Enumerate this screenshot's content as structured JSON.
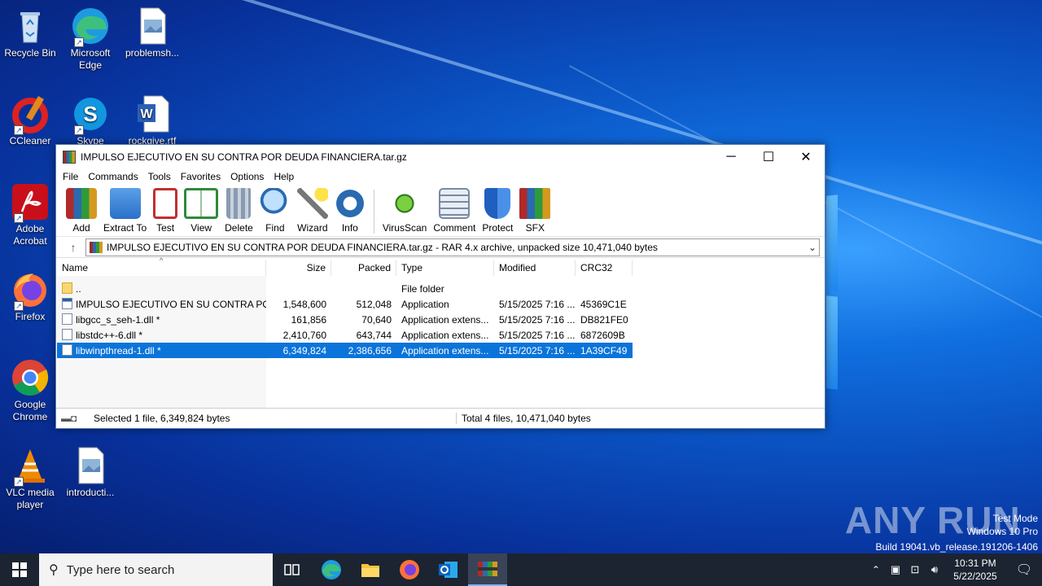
{
  "desktop": {
    "icons": [
      {
        "label": "Recycle Bin",
        "icon": "recycle-bin-icon"
      },
      {
        "label": "Microsoft Edge",
        "icon": "edge-icon"
      },
      {
        "label": "problemsh...",
        "icon": "image-file-icon"
      },
      {
        "label": "CCleaner",
        "icon": "ccleaner-icon"
      },
      {
        "label": "Skype",
        "icon": "skype-icon"
      },
      {
        "label": "rockgive.rtf",
        "icon": "word-doc-icon"
      },
      {
        "label": "Adobe Acrobat",
        "icon": "acrobat-icon"
      },
      {
        "label": "Firefox",
        "icon": "firefox-icon"
      },
      {
        "label": "Google Chrome",
        "icon": "chrome-icon"
      },
      {
        "label": "VLC media player",
        "icon": "vlc-icon"
      },
      {
        "label": "introducti...",
        "icon": "image-file-icon"
      }
    ],
    "watermark": {
      "brand": "ANY RUN",
      "line1": "Test Mode",
      "line2": "Windows 10 Pro",
      "line3": "Build 19041.vb_release.191206-1406"
    }
  },
  "window": {
    "title": "IMPULSO EJECUTIVO EN SU CONTRA POR DEUDA FINANCIERA.tar.gz",
    "menu": [
      "File",
      "Commands",
      "Tools",
      "Favorites",
      "Options",
      "Help"
    ],
    "toolbar": [
      {
        "label": "Add",
        "icon": "add-archive-icon"
      },
      {
        "label": "Extract To",
        "icon": "extract-folder-icon"
      },
      {
        "label": "Test",
        "icon": "test-clipboard-icon"
      },
      {
        "label": "View",
        "icon": "view-book-icon"
      },
      {
        "label": "Delete",
        "icon": "trash-icon"
      },
      {
        "label": "Find",
        "icon": "magnifier-icon"
      },
      {
        "label": "Wizard",
        "icon": "wand-icon"
      },
      {
        "label": "Info",
        "icon": "info-icon"
      },
      {
        "label": "VirusScan",
        "icon": "virus-icon"
      },
      {
        "label": "Comment",
        "icon": "comment-icon"
      },
      {
        "label": "Protect",
        "icon": "shield-icon"
      },
      {
        "label": "SFX",
        "icon": "sfx-icon"
      }
    ],
    "address": "IMPULSO EJECUTIVO EN SU CONTRA POR DEUDA FINANCIERA.tar.gz - RAR 4.x archive, unpacked size 10,471,040 bytes",
    "columns": [
      "Name",
      "Size",
      "Packed",
      "Type",
      "Modified",
      "CRC32"
    ],
    "rows": [
      {
        "name": "..",
        "size": "",
        "packed": "",
        "type": "File folder",
        "modified": "",
        "crc": "",
        "kind": "folder"
      },
      {
        "name": "IMPULSO EJECUTIVO EN SU CONTRA POR...",
        "size": "1,548,600",
        "packed": "512,048",
        "type": "Application",
        "modified": "5/15/2025 7:16 ...",
        "crc": "45369C1E",
        "kind": "exe"
      },
      {
        "name": "libgcc_s_seh-1.dll *",
        "size": "161,856",
        "packed": "70,640",
        "type": "Application extens...",
        "modified": "5/15/2025 7:16 ...",
        "crc": "DB821FE0",
        "kind": "dll"
      },
      {
        "name": "libstdc++-6.dll *",
        "size": "2,410,760",
        "packed": "643,744",
        "type": "Application extens...",
        "modified": "5/15/2025 7:16 ...",
        "crc": "6872609B",
        "kind": "dll"
      },
      {
        "name": "libwinpthread-1.dll *",
        "size": "6,349,824",
        "packed": "2,386,656",
        "type": "Application extens...",
        "modified": "5/15/2025 7:16 ...",
        "crc": "1A39CF49",
        "kind": "dll",
        "selected": true
      }
    ],
    "status_left": "Selected 1 file, 6,349,824 bytes",
    "status_right": "Total 4 files, 10,471,040 bytes"
  },
  "taskbar": {
    "search_placeholder": "Type here to search",
    "time": "10:31 PM",
    "date": "5/22/2025"
  }
}
